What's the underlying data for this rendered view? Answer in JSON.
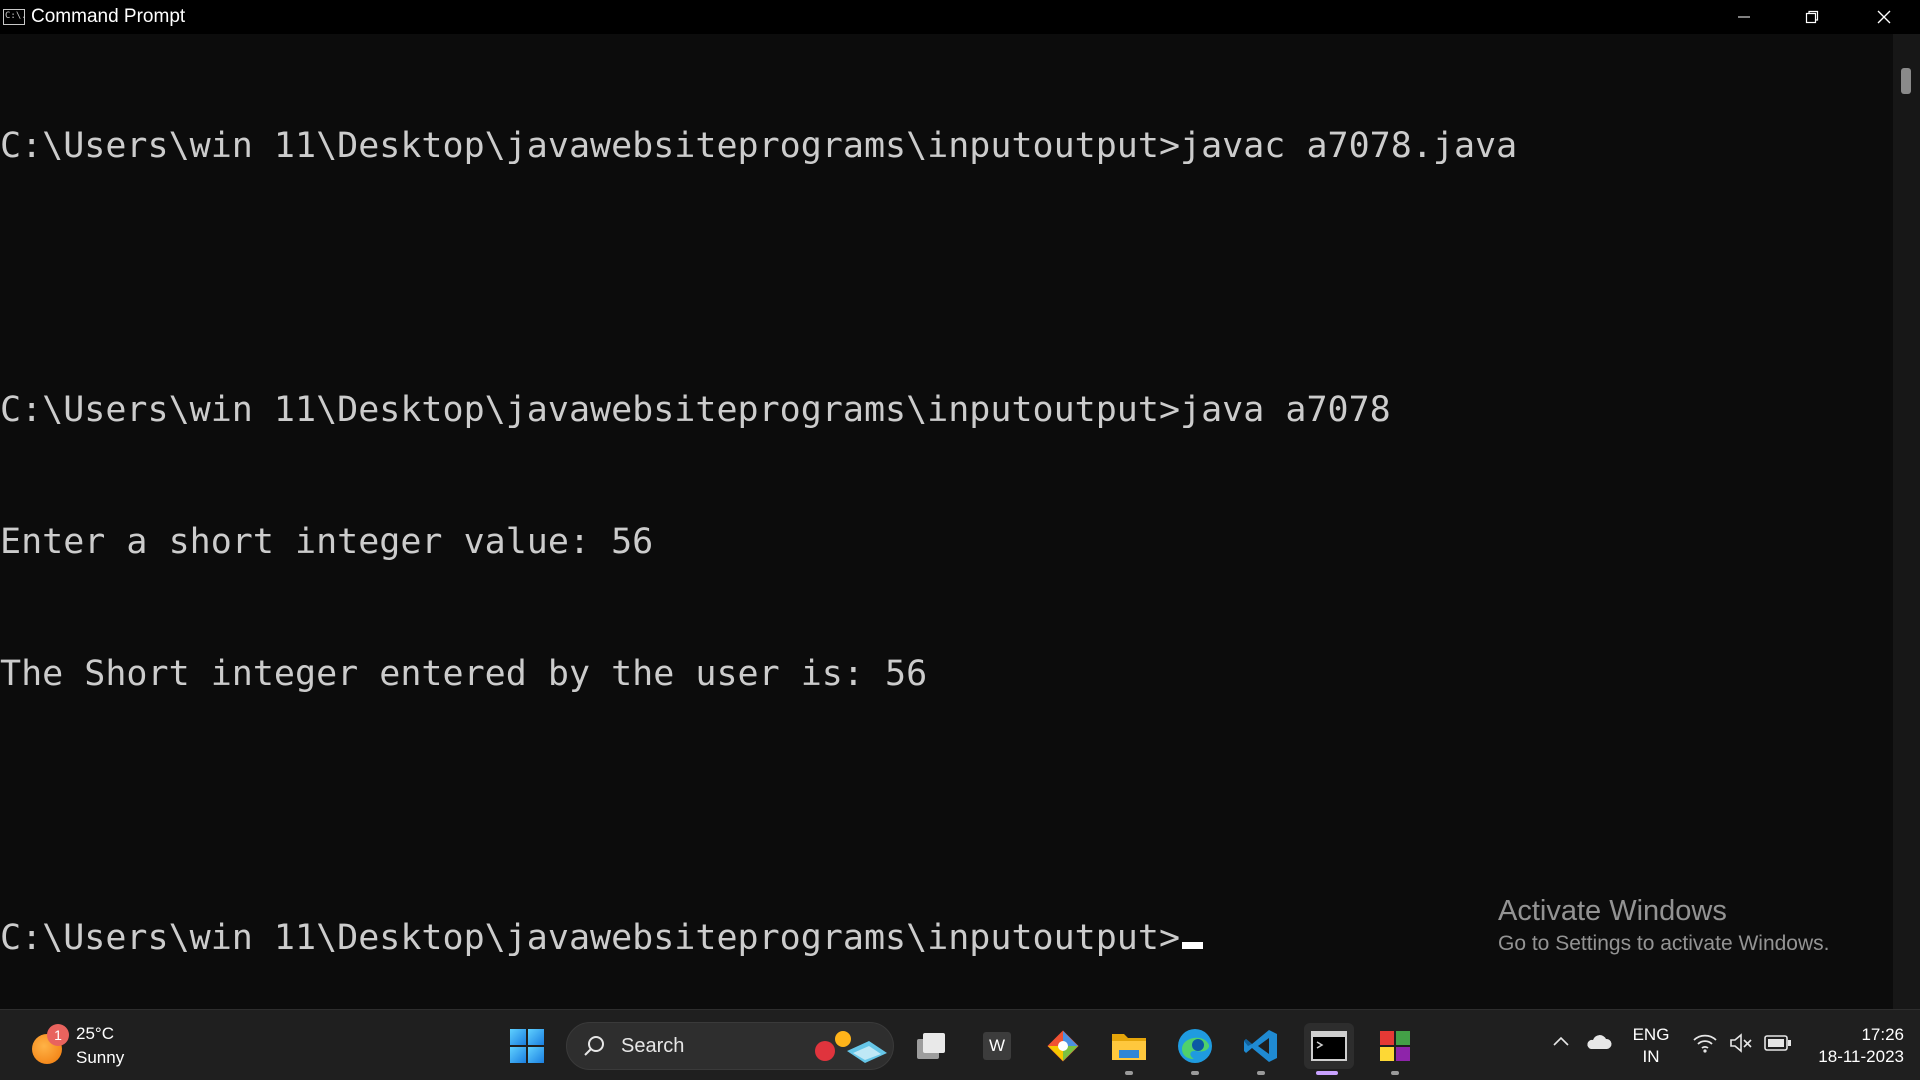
{
  "window": {
    "title": "Command Prompt",
    "app_icon_text": "C:\\.",
    "controls": [
      "minimize",
      "restore",
      "close"
    ]
  },
  "console": {
    "lines": [
      "C:\\Users\\win 11\\Desktop\\javawebsiteprograms\\inputoutput>javac a7078.java",
      "",
      "C:\\Users\\win 11\\Desktop\\javawebsiteprograms\\inputoutput>java a7078",
      "Enter a short integer value: 56",
      "The Short integer entered by the user is: 56",
      "",
      "C:\\Users\\win 11\\Desktop\\javawebsiteprograms\\inputoutput>"
    ]
  },
  "watermark": {
    "title": "Activate Windows",
    "subtitle": "Go to Settings to activate Windows."
  },
  "taskbar": {
    "weather": {
      "notification_count": "1",
      "temperature": "25°C",
      "condition": "Sunny"
    },
    "search_placeholder": "Search",
    "apps": [
      {
        "name": "start-icon"
      },
      {
        "name": "task-view-icon"
      },
      {
        "name": "word-icon",
        "label": "W"
      },
      {
        "name": "git-icon"
      },
      {
        "name": "file-explorer-icon"
      },
      {
        "name": "edge-icon"
      },
      {
        "name": "vscode-icon"
      },
      {
        "name": "command-prompt-icon"
      },
      {
        "name": "app-grid-icon"
      }
    ],
    "tray": {
      "language_line1": "ENG",
      "language_line2": "IN",
      "time": "17:26",
      "date": "18-11-2023"
    }
  }
}
